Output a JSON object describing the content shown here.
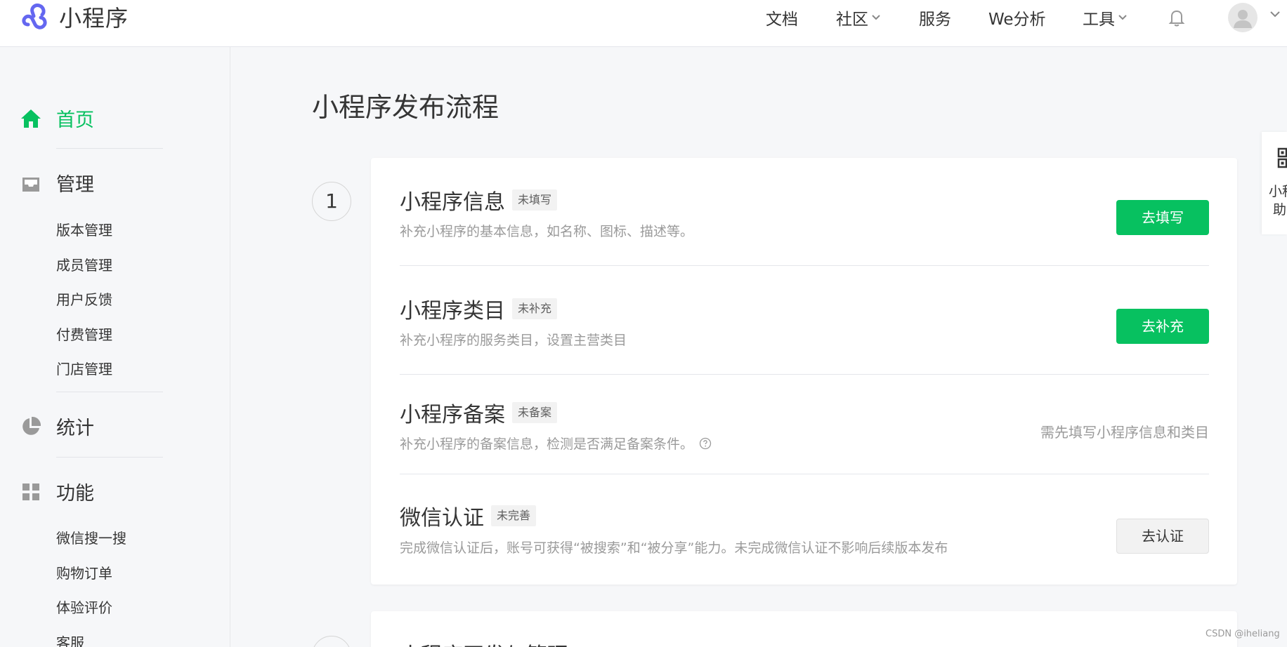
{
  "header": {
    "brand": "小程序",
    "nav": [
      {
        "label": "文档",
        "has_dropdown": false
      },
      {
        "label": "社区",
        "has_dropdown": true
      },
      {
        "label": "服务",
        "has_dropdown": false
      },
      {
        "label": "We分析",
        "has_dropdown": false
      },
      {
        "label": "工具",
        "has_dropdown": true
      }
    ]
  },
  "sidebar": {
    "sections": [
      {
        "label": "首页",
        "icon": "home-icon",
        "active": true
      },
      {
        "label": "管理",
        "icon": "inbox-icon",
        "active": false,
        "items": [
          "版本管理",
          "成员管理",
          "用户反馈",
          "付费管理",
          "门店管理"
        ]
      },
      {
        "label": "统计",
        "icon": "pie-chart-icon",
        "active": false
      },
      {
        "label": "功能",
        "icon": "grid-icon",
        "active": false,
        "items": [
          "微信搜一搜",
          "购物订单",
          "体验评价",
          "客服"
        ]
      }
    ]
  },
  "main": {
    "title": "小程序发布流程",
    "steps": [
      {
        "number": "1",
        "rows": [
          {
            "title": "小程序信息",
            "tag": "未填写",
            "desc": "补充小程序的基本信息，如名称、图标、描述等。",
            "action": "去填写",
            "action_style": "primary"
          },
          {
            "title": "小程序类目",
            "tag": "未补充",
            "desc": "补充小程序的服务类目，设置主营类目",
            "action": "去补充",
            "action_style": "primary"
          },
          {
            "title": "小程序备案",
            "tag": "未备案",
            "desc": "补充小程序的备案信息，检测是否满足备案条件。",
            "hint": "需先填写小程序信息和类目"
          },
          {
            "title": "微信认证",
            "tag": "未完善",
            "desc": "完成微信认证后，账号可获得“被搜索”和“被分享”能力。未完成微信认证不影响后续版本发布",
            "action": "去认证",
            "action_style": "default"
          }
        ]
      },
      {
        "title": "小程序开发与管理"
      }
    ]
  },
  "helper": {
    "text_line1": "小程",
    "text_line2": "助"
  },
  "watermark": "CSDN @iheliang",
  "colors": {
    "accent": "#07c160",
    "brand_purple": "#6467f0"
  }
}
